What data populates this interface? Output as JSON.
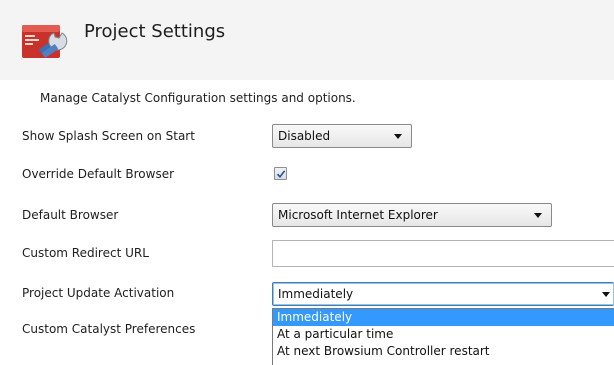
{
  "header": {
    "icon": "settings-wrench-icon",
    "title": "Project Settings"
  },
  "description": "Manage Catalyst Configuration settings and options.",
  "settings": {
    "splash_screen": {
      "label": "Show Splash Screen on Start",
      "value": "Disabled"
    },
    "override_browser": {
      "label": "Override Default Browser",
      "checked": true
    },
    "default_browser": {
      "label": "Default Browser",
      "value": "Microsoft Internet Explorer"
    },
    "redirect_url": {
      "label": "Custom Redirect URL",
      "value": ""
    },
    "update_activation": {
      "label": "Project Update Activation",
      "value": "Immediately",
      "options": [
        "Immediately",
        "At a particular time",
        "At next Browsium Controller restart"
      ]
    },
    "catalyst_preferences": {
      "label": "Custom Catalyst Preferences"
    }
  },
  "colors": {
    "accent_selection": "#3399ff",
    "header_background": "#f4f4f4"
  }
}
